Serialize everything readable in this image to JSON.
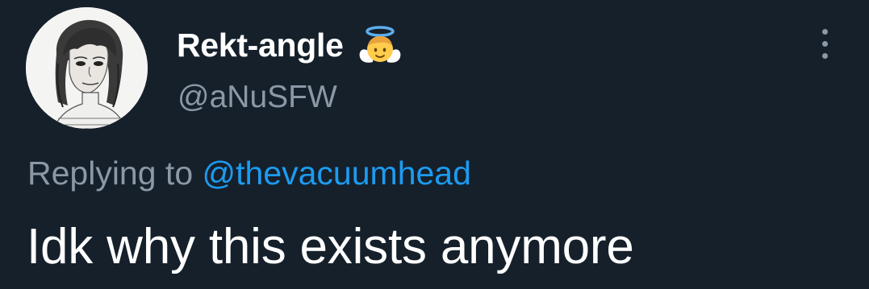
{
  "tweet": {
    "author": {
      "display_name": "Rekt-angle",
      "handle": "@aNuSFW",
      "avatar_icon": "sketch-portrait-avatar",
      "badge_emoji_icon": "angel-halo-emoji-icon"
    },
    "replying_prefix": "Replying to ",
    "replying_mention": "@thevacuumhead",
    "text": "Idk why this exists anymore",
    "more_icon": "more-vertical-icon"
  },
  "colors": {
    "background": "#15202b",
    "primary_text": "#ffffff",
    "secondary_text": "#8b98a5",
    "link": "#1d9bf0"
  }
}
